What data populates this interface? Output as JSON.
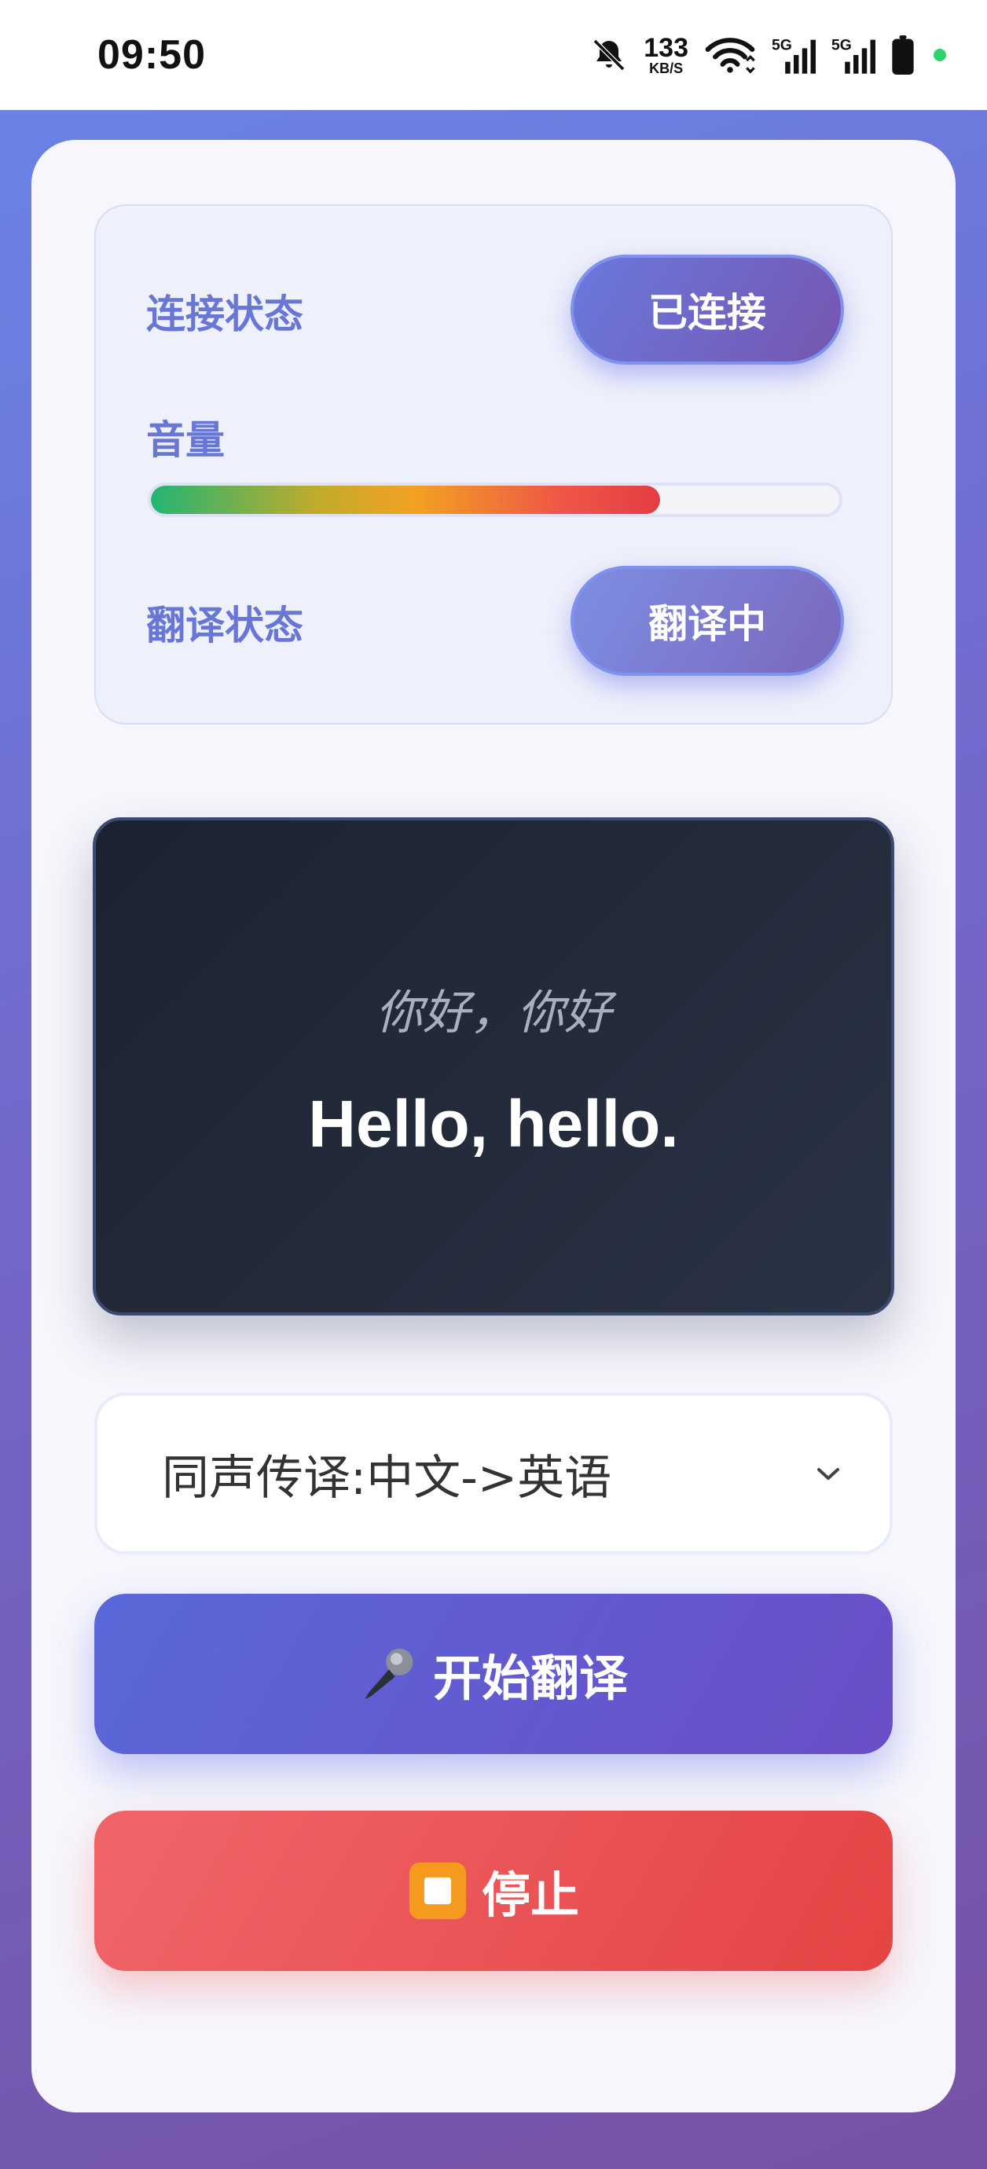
{
  "status_bar": {
    "time": "09:50",
    "net_speed": "133",
    "net_speed_unit": "KB/S",
    "icons": [
      "bell-off-icon",
      "wifi-icon",
      "signal-5g-icon",
      "signal-5g-icon",
      "battery-icon"
    ]
  },
  "status_panel": {
    "connection_label": "连接状态",
    "connection_value": "已连接",
    "volume_label": "音量",
    "volume_level_percent": 74,
    "translation_label": "翻译状态",
    "translation_value": "翻译中"
  },
  "display": {
    "source_text": "你好，你好",
    "translated_text": "Hello, hello."
  },
  "mode_select": {
    "selected": "同声传译:中文->英语"
  },
  "actions": {
    "start_label": "开始翻译",
    "start_icon": "microphone-icon",
    "stop_label": "停止",
    "stop_icon": "stop-square-icon"
  },
  "colors": {
    "accent": "#6a79dc",
    "label": "#6877d5",
    "stop": "#e54444",
    "display_bg": "#1c2230"
  }
}
